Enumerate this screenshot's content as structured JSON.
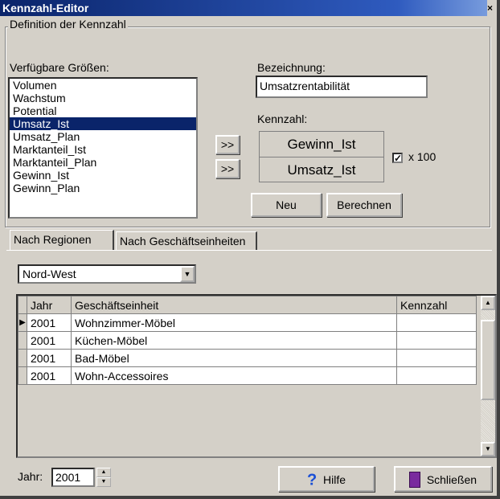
{
  "window": {
    "title": "Kennzahl-Editor",
    "close_glyph": "×"
  },
  "definition": {
    "group_label": "Definition der Kennzahl",
    "available_label": "Verfügbare Größen:",
    "items": [
      "Volumen",
      "Wachstum",
      "Potential",
      "Umsatz_Ist",
      "Umsatz_Plan",
      "Marktanteil_Ist",
      "Marktanteil_Plan",
      "Gewinn_Ist",
      "Gewinn_Plan"
    ],
    "selected_index": 3,
    "move_up_label": ">>",
    "move_down_label": ">>",
    "name_label": "Bezeichnung:",
    "name_value": "Umsatzrentabilität",
    "ratio_label": "Kennzahl:",
    "numerator": "Gewinn_Ist",
    "denominator": "Umsatz_Ist",
    "x100_checked": true,
    "x100_label": "x 100",
    "new_button": "Neu",
    "calc_button": "Berechnen"
  },
  "tabs": {
    "regions": "Nach Regionen",
    "units": "Nach Geschäftseinheiten",
    "active": "regions"
  },
  "region_select": {
    "value": "Nord-West"
  },
  "table": {
    "columns": [
      "Jahr",
      "Geschäftseinheit",
      "Kennzahl"
    ],
    "rows": [
      {
        "jahr": "2001",
        "einheit": "Wohnzimmer-Möbel",
        "kennzahl": ""
      },
      {
        "jahr": "2001",
        "einheit": "Küchen-Möbel",
        "kennzahl": ""
      },
      {
        "jahr": "2001",
        "einheit": "Bad-Möbel",
        "kennzahl": ""
      },
      {
        "jahr": "2001",
        "einheit": "Wohn-Accessoires",
        "kennzahl": ""
      }
    ]
  },
  "footer": {
    "year_label": "Jahr:",
    "year_value": "2001",
    "help_button": "Hilfe",
    "close_button": "Schließen"
  },
  "icons": {
    "help": "question-mark-icon",
    "close": "exit-door-icon"
  },
  "colors": {
    "title_bar": "#0a246a",
    "selection": "#0a246a",
    "face": "#d4d0c8"
  }
}
